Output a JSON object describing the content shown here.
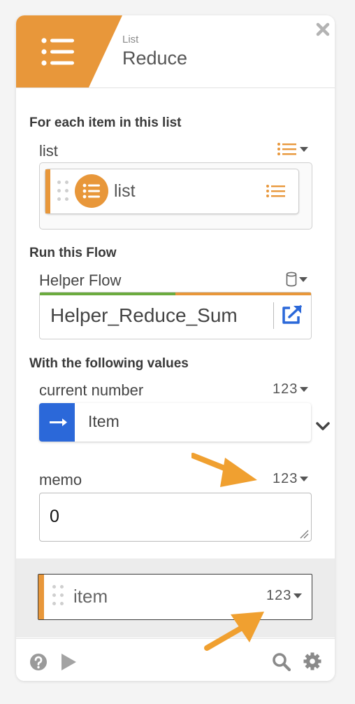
{
  "header": {
    "block_type": "List",
    "block_title": "Reduce",
    "accent_color": "#e8973a",
    "icon": "list-icon",
    "close_icon": "close-icon"
  },
  "sections": {
    "list_section": {
      "title": "For each item in this list",
      "field_label": "list",
      "type_icon": "list-type-icon",
      "value_label": "list"
    },
    "flow_section": {
      "title": "Run this Flow",
      "field_label": "Helper Flow",
      "type_icon": "flow-type-icon",
      "value": "Helper_Reduce_Sum",
      "open_icon": "open-external-icon"
    },
    "values_section": {
      "title": "With the following values",
      "current_number": {
        "label": "current number",
        "type": "123",
        "value": "Item",
        "icon": "arrow-right-icon",
        "expand_icon": "chevron-down-icon"
      },
      "memo": {
        "label": "memo",
        "type": "123",
        "value": "0"
      }
    }
  },
  "output": {
    "label": "item",
    "type": "123"
  },
  "footer": {
    "help_icon": "help-icon",
    "run_icon": "play-icon",
    "search_icon": "search-icon",
    "settings_icon": "gear-icon"
  },
  "colors": {
    "orange": "#e8973a",
    "blue": "#2b68d9",
    "green": "#6bab3e",
    "annotation_arrow": "#f0a030"
  }
}
